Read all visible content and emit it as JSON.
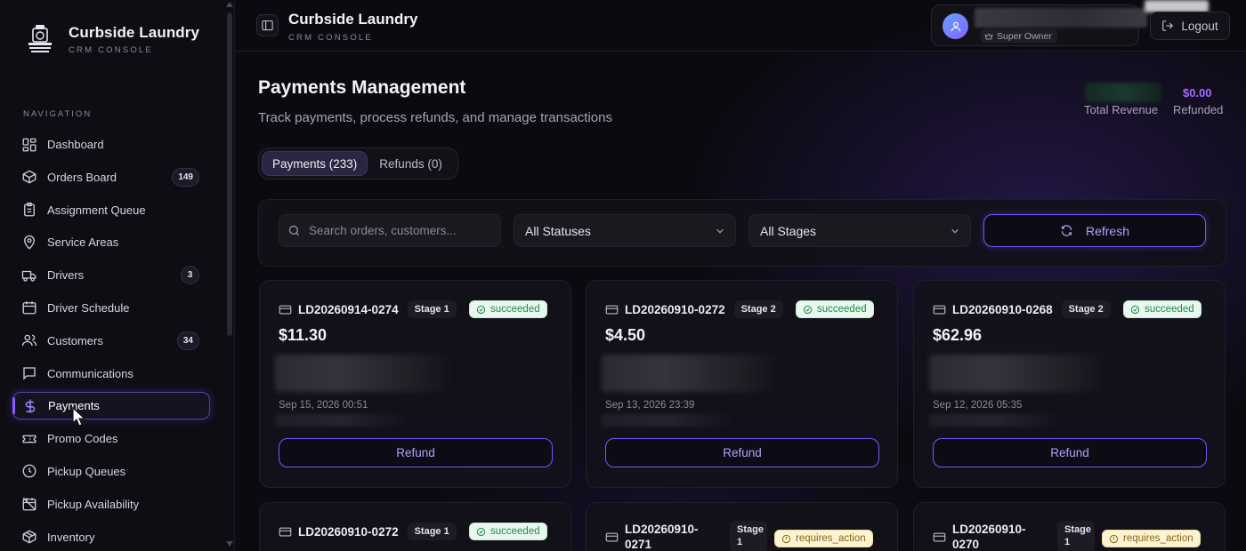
{
  "brand": {
    "name": "Curbside Laundry",
    "subtitle": "CRM CONSOLE",
    "logo_text": "CURBSIDE LAUNDRY"
  },
  "sidebar": {
    "heading": "NAVIGATION",
    "items": [
      {
        "label": "Dashboard",
        "icon": "dashboard-icon"
      },
      {
        "label": "Orders Board",
        "icon": "box-icon",
        "badge": "149"
      },
      {
        "label": "Assignment Queue",
        "icon": "clipboard-icon"
      },
      {
        "label": "Service Areas",
        "icon": "map-pin-icon"
      },
      {
        "label": "Drivers",
        "icon": "truck-icon",
        "badge": "3"
      },
      {
        "label": "Driver Schedule",
        "icon": "calendar-icon"
      },
      {
        "label": "Customers",
        "icon": "users-icon",
        "badge": "34"
      },
      {
        "label": "Communications",
        "icon": "message-icon"
      },
      {
        "label": "Payments",
        "icon": "dollar-icon",
        "active": true
      },
      {
        "label": "Promo Codes",
        "icon": "ticket-icon"
      },
      {
        "label": "Pickup Queues",
        "icon": "clock-icon"
      },
      {
        "label": "Pickup Availability",
        "icon": "calendar-off-icon"
      },
      {
        "label": "Inventory",
        "icon": "package-icon"
      }
    ]
  },
  "topbar": {
    "title": "Curbside Laundry",
    "subtitle": "CRM CONSOLE",
    "user_role": "Super Owner",
    "logout_label": "Logout"
  },
  "page": {
    "title": "Payments Management",
    "subtitle": "Track payments, process refunds, and manage transactions",
    "stats": {
      "revenue_label": "Total Revenue",
      "refunded_value": "$0.00",
      "refunded_label": "Refunded"
    }
  },
  "tabs": [
    {
      "label": "Payments (233)",
      "active": true
    },
    {
      "label": "Refunds (0)",
      "active": false
    }
  ],
  "filters": {
    "search_placeholder": "Search orders, customers...",
    "status_select": "All Statuses",
    "stage_select": "All Stages",
    "refresh_label": "Refresh"
  },
  "payments": [
    {
      "id": "LD20260914-0274",
      "stage": "Stage 1",
      "status": "succeeded",
      "amount": "$11.30",
      "date": "Sep 15, 2026 00:51",
      "action": "Refund"
    },
    {
      "id": "LD20260910-0272",
      "stage": "Stage 2",
      "status": "succeeded",
      "amount": "$4.50",
      "date": "Sep 13, 2026 23:39",
      "action": "Refund"
    },
    {
      "id": "LD20260910-0268",
      "stage": "Stage 2",
      "status": "succeeded",
      "amount": "$62.96",
      "date": "Sep 12, 2026 05:35",
      "action": "Refund"
    },
    {
      "id": "LD20260910-0272",
      "stage": "Stage 1",
      "status": "succeeded"
    },
    {
      "id": "LD20260910-0271",
      "stage": "Stage 1",
      "status": "requires_action"
    },
    {
      "id": "LD20260910-0270",
      "stage": "Stage 1",
      "status": "requires_action"
    }
  ],
  "colors": {
    "accent": "#7a55ff",
    "accent_text": "#b79cff",
    "success_bg": "#e9f8ee",
    "success_text": "#1e8a4a",
    "warning_bg": "#fbf3d3",
    "warning_text": "#8a6412",
    "refunded_text": "#a56bff"
  }
}
